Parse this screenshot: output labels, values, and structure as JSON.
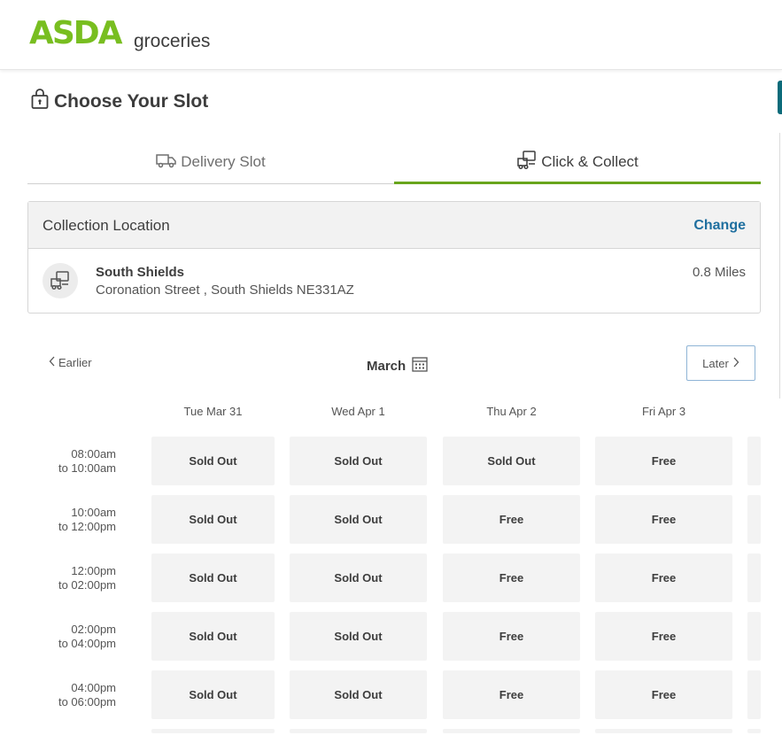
{
  "brand": {
    "logo": "ASDA",
    "sub": "groceries"
  },
  "page_title": "Choose Your Slot",
  "tabs": [
    {
      "label": "Delivery Slot",
      "active": false
    },
    {
      "label": "Click & Collect",
      "active": true
    }
  ],
  "collection": {
    "heading": "Collection Location",
    "change_label": "Change",
    "store_name": "South Shields",
    "store_address": "Coronation Street , South Shields NE331AZ",
    "distance": "0.8 Miles"
  },
  "calendar": {
    "earlier_label": "Earlier",
    "month": "March",
    "later_label": "Later"
  },
  "days": [
    "Tue Mar 31",
    "Wed Apr 1",
    "Thu Apr 2",
    "Fri Apr 3"
  ],
  "rows": [
    {
      "from": "08:00am",
      "to": "to 10:00am",
      "slots": [
        "Sold Out",
        "Sold Out",
        "Sold Out",
        "Free"
      ]
    },
    {
      "from": "10:00am",
      "to": "to 12:00pm",
      "slots": [
        "Sold Out",
        "Sold Out",
        "Free",
        "Free"
      ]
    },
    {
      "from": "12:00pm",
      "to": "to 02:00pm",
      "slots": [
        "Sold Out",
        "Sold Out",
        "Free",
        "Free"
      ]
    },
    {
      "from": "02:00pm",
      "to": "to 04:00pm",
      "slots": [
        "Sold Out",
        "Sold Out",
        "Free",
        "Free"
      ]
    },
    {
      "from": "04:00pm",
      "to": "to 06:00pm",
      "slots": [
        "Sold Out",
        "Sold Out",
        "Free",
        "Free"
      ]
    }
  ],
  "colors": {
    "brand_green": "#78be20",
    "tab_underline": "#68a51c",
    "link_blue": "#1f6f9f"
  },
  "icons": {
    "title": "lock-bag-icon",
    "delivery": "truck-icon",
    "collect": "collect-van-icon",
    "store": "collect-van-icon",
    "calendar": "calendar-icon"
  }
}
